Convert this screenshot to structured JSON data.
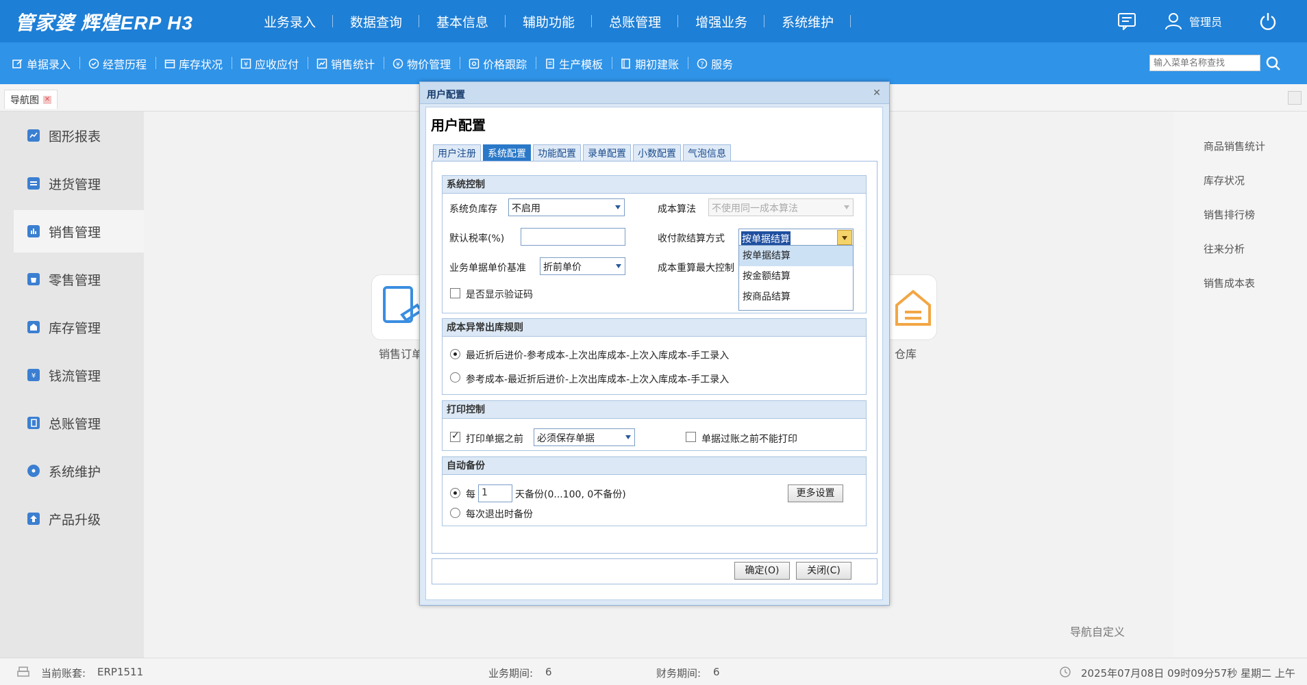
{
  "app": {
    "logo": "管家婆 辉煌ERP H3"
  },
  "topmenu": [
    "业务录入",
    "数据查询",
    "基本信息",
    "辅助功能",
    "总账管理",
    "增强业务",
    "系统维护"
  ],
  "topright": {
    "user": "管理员"
  },
  "toolbar": {
    "items": [
      "单据录入",
      "经营历程",
      "库存状况",
      "应收应付",
      "销售统计",
      "物价管理",
      "价格跟踪",
      "生产模板",
      "期初建账",
      "服务"
    ],
    "search_placeholder": "输入菜单名称查找"
  },
  "tabstrip": {
    "tab": "导航图"
  },
  "sidebar": {
    "items": [
      "图形报表",
      "进货管理",
      "销售管理",
      "零售管理",
      "库存管理",
      "钱流管理",
      "总账管理",
      "系统维护",
      "产品升级"
    ],
    "active": "销售管理"
  },
  "main": {
    "card_left_label": "销售订单",
    "card_right_label": "仓库",
    "nav_custom": "导航自定义"
  },
  "rightpanel": {
    "items": [
      "商品销售统计",
      "库存状况",
      "销售排行榜",
      "往来分析",
      "销售成本表"
    ]
  },
  "statusbar": {
    "account_label": "当前账套:",
    "account_value": "ERP1511",
    "biz_period_label": "业务期间:",
    "biz_period_value": "6",
    "fin_period_label": "财务期间:",
    "fin_period_value": "6",
    "datetime": "2025年07月08日 09时09分57秒 星期二 上午"
  },
  "dialog": {
    "title": "用户配置",
    "heading": "用户配置",
    "tabs": [
      "用户注册",
      "系统配置",
      "功能配置",
      "录单配置",
      "小数配置",
      "气泡信息"
    ],
    "active_tab": "系统配置",
    "sys_control": {
      "header": "系统控制",
      "neg_stock_label": "系统负库存",
      "neg_stock_value": "不启用",
      "cost_method_label": "成本算法",
      "cost_method_value": "不使用同一成本算法",
      "tax_label": "默认税率(%)",
      "tax_value": "",
      "settle_label": "收付款结算方式",
      "settle_value": "按单据结算",
      "settle_options": [
        "按单据结算",
        "按金额结算",
        "按商品结算"
      ],
      "price_base_label": "业务单据单价基准",
      "price_base_value": "折前单价",
      "cost_recalc_label": "成本重算最大控制",
      "captcha_label": "是否显示验证码",
      "captcha_checked": false
    },
    "cost_rule": {
      "header": "成本异常出库规则",
      "opt1": "最近折后进价-参考成本-上次出库成本-上次入库成本-手工录入",
      "opt2": "参考成本-最近折后进价-上次出库成本-上次入库成本-手工录入",
      "selected": 1
    },
    "print": {
      "header": "打印控制",
      "before_print_label": "打印单据之前",
      "before_print_checked": true,
      "before_print_value": "必须保存单据",
      "no_print_label": "单据过账之前不能打印",
      "no_print_checked": false
    },
    "backup": {
      "header": "自动备份",
      "every_label": "每",
      "every_value": "1",
      "every_suffix": "天备份(0...100, 0不备份)",
      "exit_label": "每次退出时备份",
      "more_btn": "更多设置",
      "selected": 1
    },
    "ok_btn": "确定(O)",
    "close_btn": "关闭(C)"
  }
}
